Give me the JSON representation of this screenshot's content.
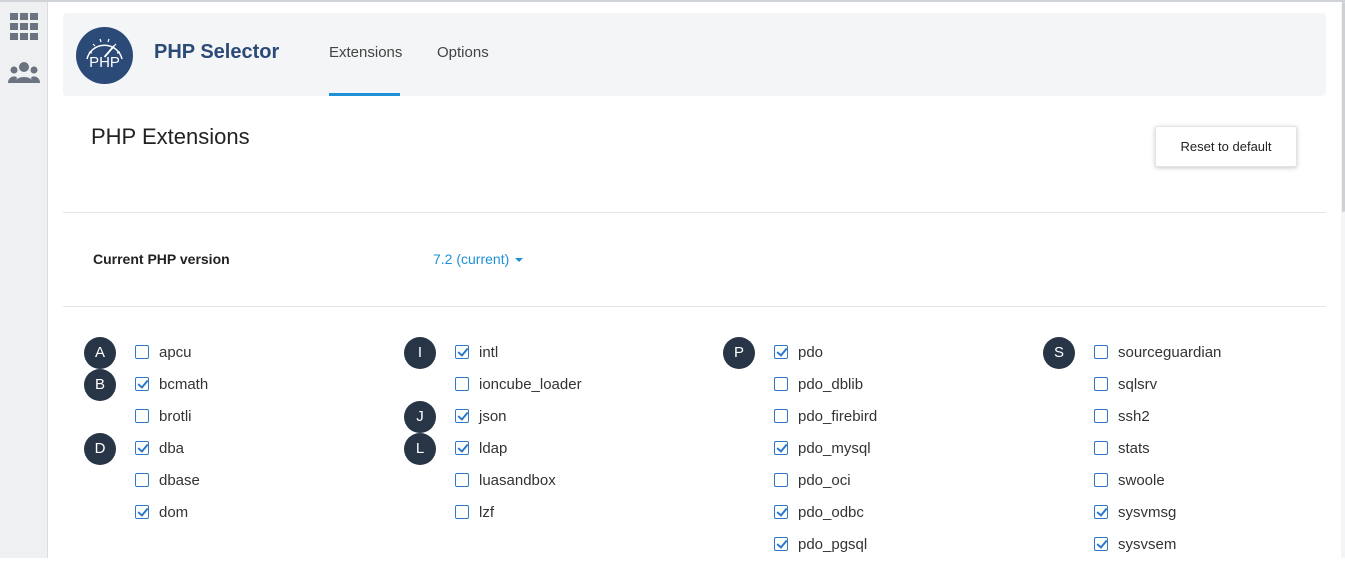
{
  "rail": {
    "items": [
      {
        "icon": "grid-icon"
      },
      {
        "icon": "users-icon"
      }
    ]
  },
  "header": {
    "logo_text": "PHP",
    "title": "PHP Selector",
    "tabs": [
      {
        "label": "Extensions",
        "active": true
      },
      {
        "label": "Options",
        "active": false
      }
    ]
  },
  "page": {
    "heading": "PHP Extensions",
    "reset_label": "Reset to default",
    "version_label": "Current PHP version",
    "version_value": "7.2 (current)"
  },
  "colors": {
    "accent": "#1e90d6",
    "title": "#2b4a77",
    "badge": "#283547",
    "checkbox": "#2e78c7"
  },
  "extensions": [
    [
      {
        "letter": "A",
        "items": [
          {
            "name": "apcu",
            "checked": false
          }
        ]
      },
      {
        "letter": "B",
        "items": [
          {
            "name": "bcmath",
            "checked": true
          },
          {
            "name": "brotli",
            "checked": false
          }
        ]
      },
      {
        "letter": "D",
        "items": [
          {
            "name": "dba",
            "checked": true
          },
          {
            "name": "dbase",
            "checked": false
          },
          {
            "name": "dom",
            "checked": true
          }
        ]
      }
    ],
    [
      {
        "letter": "I",
        "items": [
          {
            "name": "intl",
            "checked": true
          },
          {
            "name": "ioncube_loader",
            "checked": false
          }
        ]
      },
      {
        "letter": "J",
        "items": [
          {
            "name": "json",
            "checked": true
          }
        ]
      },
      {
        "letter": "L",
        "items": [
          {
            "name": "ldap",
            "checked": true
          },
          {
            "name": "luasandbox",
            "checked": false
          },
          {
            "name": "lzf",
            "checked": false
          }
        ]
      }
    ],
    [
      {
        "letter": "P",
        "items": [
          {
            "name": "pdo",
            "checked": true
          },
          {
            "name": "pdo_dblib",
            "checked": false
          },
          {
            "name": "pdo_firebird",
            "checked": false
          },
          {
            "name": "pdo_mysql",
            "checked": true
          },
          {
            "name": "pdo_oci",
            "checked": false
          },
          {
            "name": "pdo_odbc",
            "checked": true
          },
          {
            "name": "pdo_pgsql",
            "checked": true
          }
        ]
      }
    ],
    [
      {
        "letter": "S",
        "items": [
          {
            "name": "sourceguardian",
            "checked": false
          },
          {
            "name": "sqlsrv",
            "checked": false
          },
          {
            "name": "ssh2",
            "checked": false
          },
          {
            "name": "stats",
            "checked": false
          },
          {
            "name": "swoole",
            "checked": false
          },
          {
            "name": "sysvmsg",
            "checked": true
          },
          {
            "name": "sysvsem",
            "checked": true
          }
        ]
      }
    ]
  ]
}
